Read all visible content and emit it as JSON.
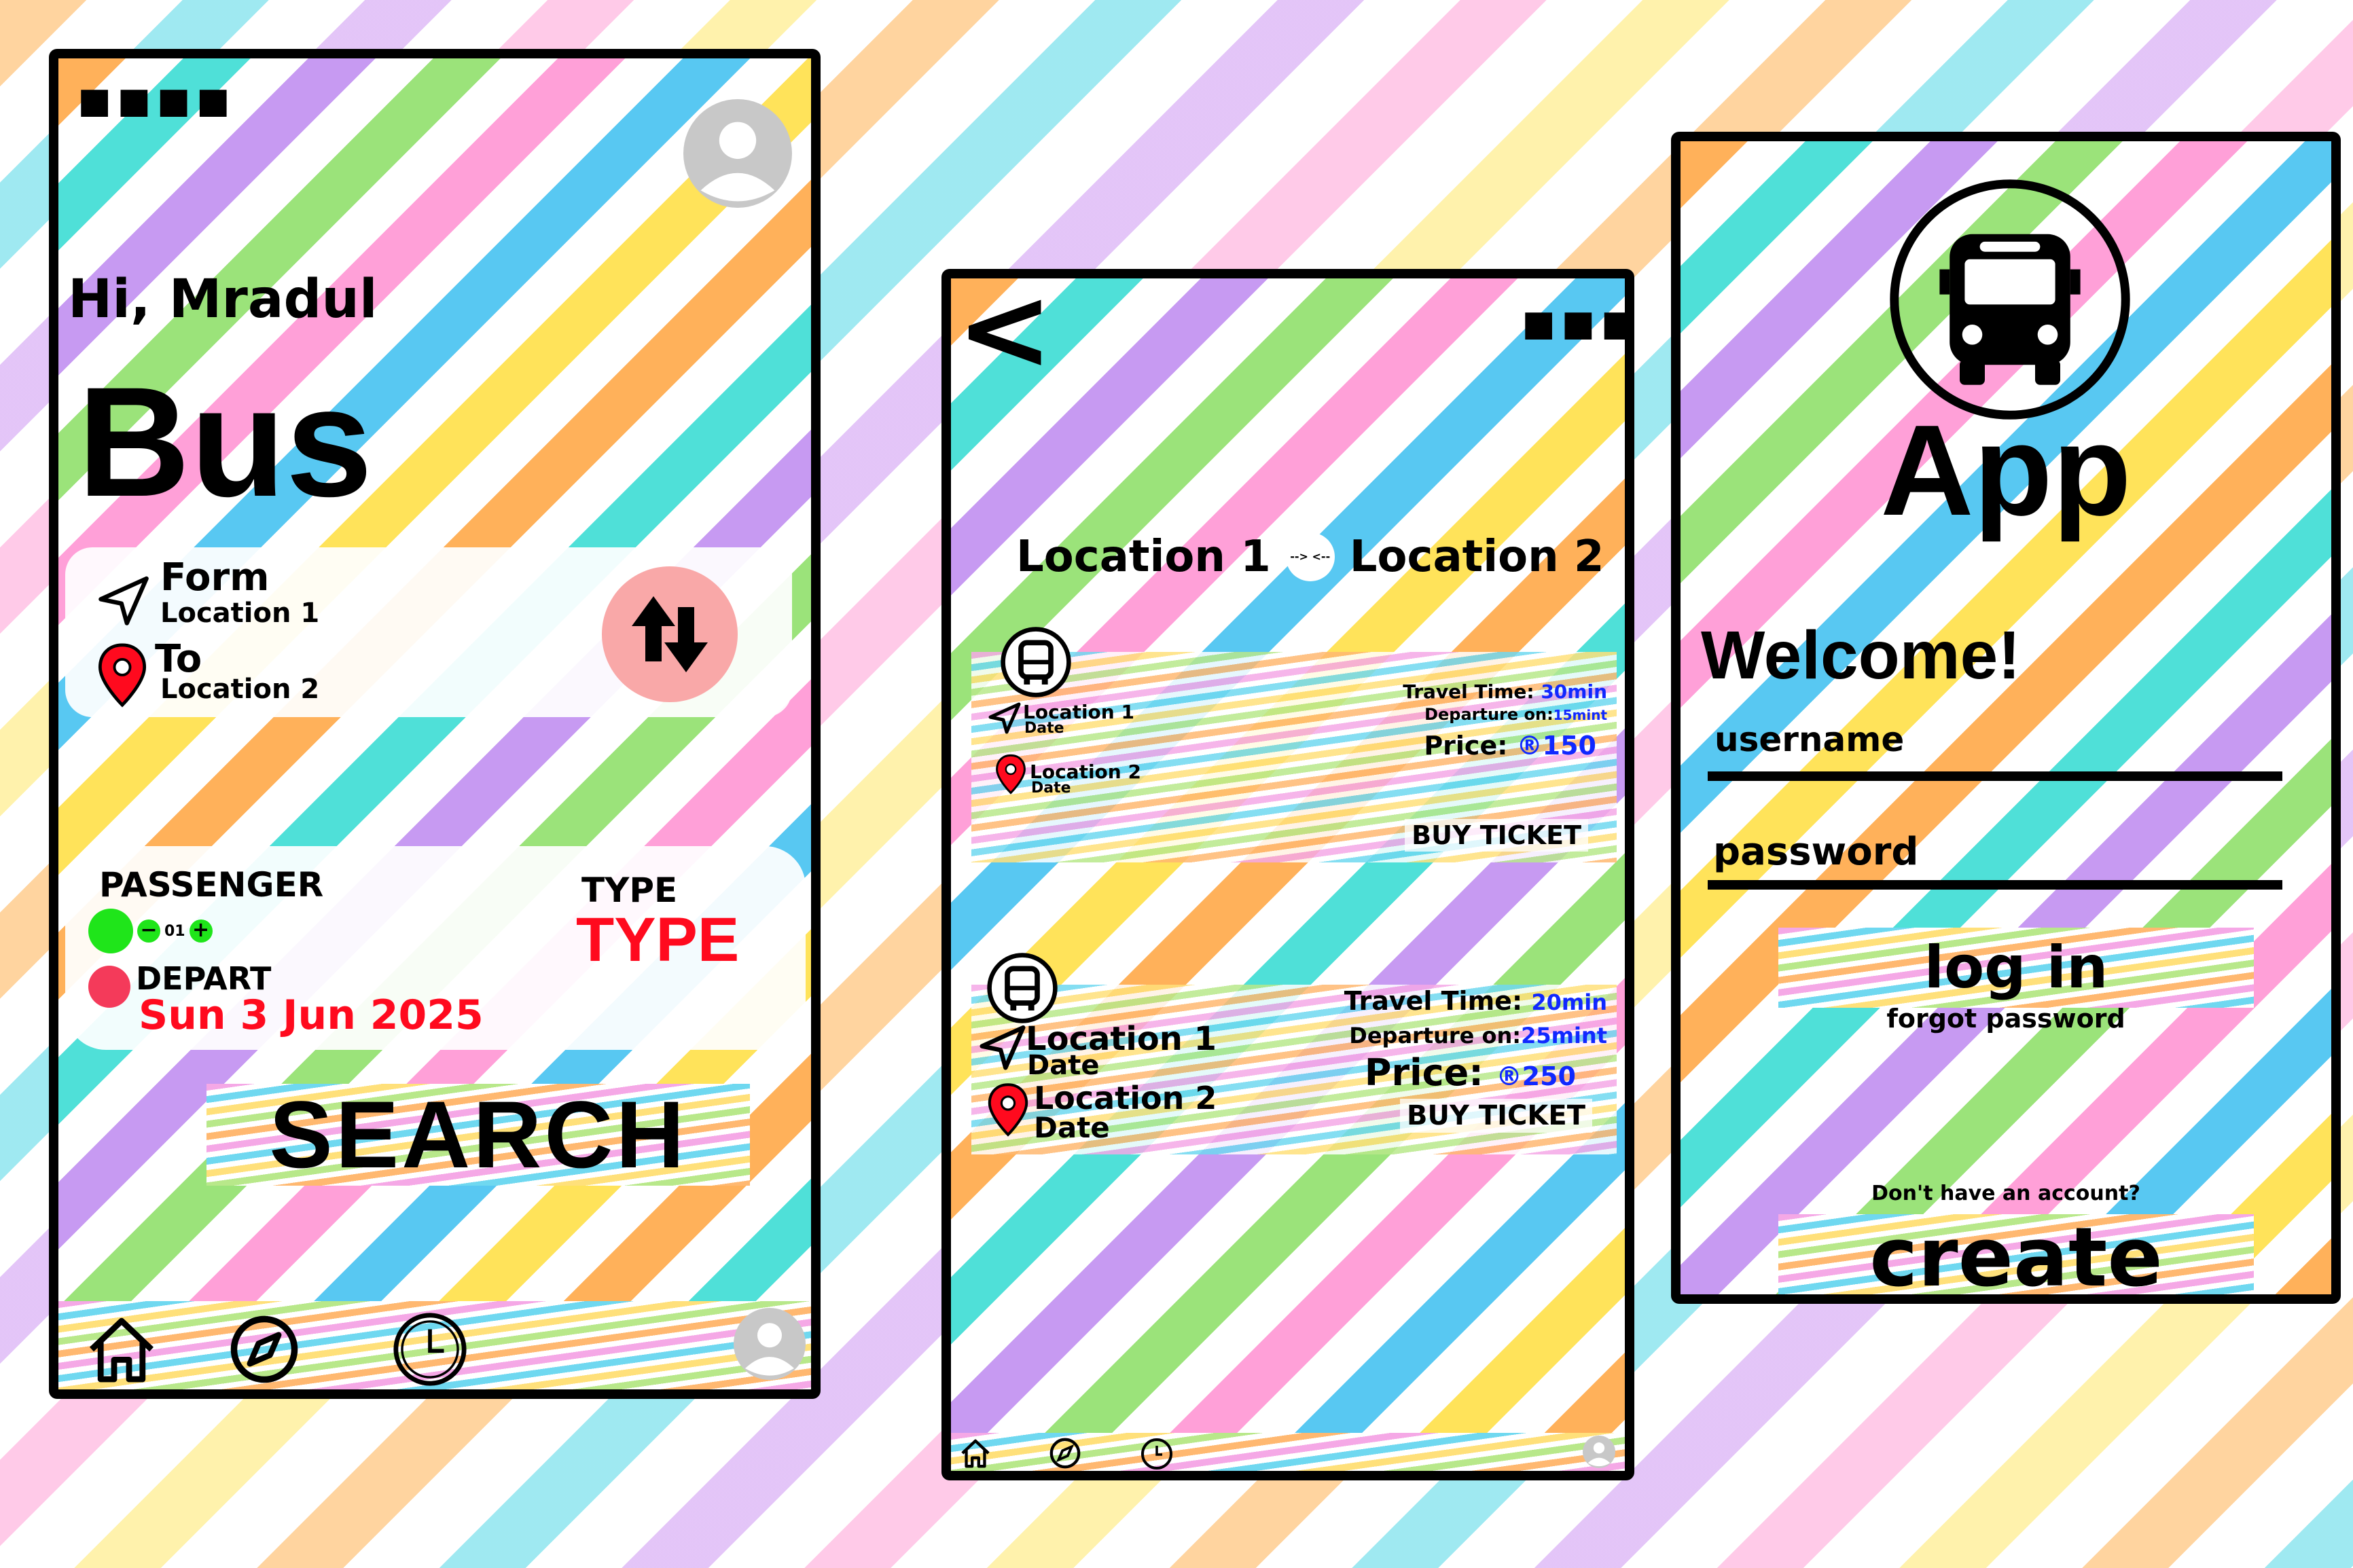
{
  "home": {
    "status_dots": "▪▪▪▪",
    "greeting": "Hi, Mradul",
    "title": "Bus",
    "from_label": "Form",
    "from_value": "Location 1",
    "to_label": "To",
    "to_value": "Location 2",
    "passenger_label": "PASSENGER",
    "passenger_count": "01",
    "type_label": "TYPE",
    "type_value": "TYPE",
    "depart_label": "DEPART",
    "depart_date": "Sun 3 Jun 2025",
    "search_label": "SEARCH"
  },
  "results": {
    "back_glyph": "<",
    "route_from": "Location 1",
    "route_to": "Location 2",
    "swap_glyph": "--> <--",
    "tickets": [
      {
        "from": "Location 1",
        "from_sub": "Date",
        "to": "Location 2",
        "to_sub": "Date",
        "travel_label": "Travel Time:",
        "travel_value": "30min",
        "departure_label": "Departure on:",
        "departure_value": "15mint",
        "price_label": "Price:",
        "price_value": "®150",
        "buy_label": "BUY TICKET"
      },
      {
        "from": "Location 1",
        "from_sub": "Date",
        "to": "Location 2",
        "to_sub": "Date",
        "travel_label": "Travel Time:",
        "travel_value": "20min",
        "departure_label": "Departure on:",
        "departure_value": "25mint",
        "price_label": "Price:",
        "price_value": "®250",
        "buy_label": "BUY TICKET"
      }
    ]
  },
  "login": {
    "title": "App",
    "welcome": "Welcome!",
    "username_placeholder": "username",
    "password_placeholder": "password",
    "login_label": "log in",
    "forgot_label": "forgot password",
    "no_account": "Don't have an account?",
    "create_label": "create"
  },
  "colors": {
    "accent_red": "#ff0a1e",
    "price_blue": "#1028ff",
    "passenger_green": "#1fe51a",
    "swap_button_pink": "#f9a8a8",
    "frame": "#000000"
  },
  "icons": [
    "signal-dots-icon",
    "avatar-icon",
    "navigation-arrow-icon",
    "map-pin-icon",
    "swap-arrows-icon",
    "home-icon",
    "compass-icon",
    "clock-icon",
    "bus-icon",
    "back-arrow-icon"
  ]
}
